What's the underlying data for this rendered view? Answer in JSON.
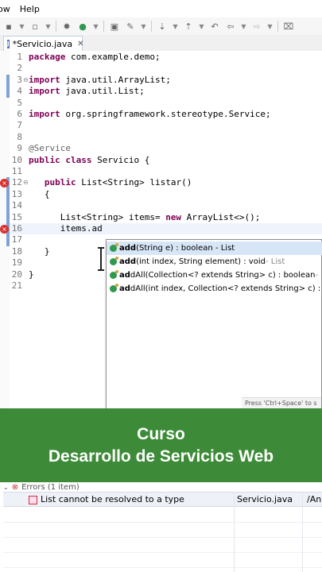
{
  "menu": {
    "items": [
      "ow",
      "Help"
    ]
  },
  "editor_tab": {
    "title": "*Servicio.java",
    "close": "✕"
  },
  "code": {
    "lines": [
      {
        "n": "1",
        "parts": [
          [
            "kw",
            "package"
          ],
          [
            "txt",
            " com.example.demo;"
          ]
        ]
      },
      {
        "n": "2",
        "parts": []
      },
      {
        "n": "3",
        "parts": [
          [
            "kw",
            "import"
          ],
          [
            "txt",
            " java.util.ArrayList;"
          ]
        ]
      },
      {
        "n": "4",
        "parts": [
          [
            "kw",
            "import"
          ],
          [
            "txt",
            " java.util.List;"
          ]
        ]
      },
      {
        "n": "5",
        "parts": []
      },
      {
        "n": "6",
        "parts": [
          [
            "kw",
            "import"
          ],
          [
            "txt",
            " org.springframework.stereotype.Service;"
          ]
        ]
      },
      {
        "n": "7",
        "parts": []
      },
      {
        "n": "8",
        "parts": []
      },
      {
        "n": "9",
        "parts": [
          [
            "ann",
            "@Service"
          ]
        ]
      },
      {
        "n": "10",
        "parts": [
          [
            "kw",
            "public class"
          ],
          [
            "txt",
            " Servicio {"
          ]
        ]
      },
      {
        "n": "11",
        "parts": []
      },
      {
        "n": "12",
        "parts": [
          [
            "txt",
            "   "
          ],
          [
            "kw",
            "public"
          ],
          [
            "txt",
            " List<String> listar()"
          ]
        ]
      },
      {
        "n": "13",
        "parts": [
          [
            "txt",
            "   {"
          ]
        ]
      },
      {
        "n": "14",
        "parts": []
      },
      {
        "n": "15",
        "parts": [
          [
            "txt",
            "      List<String> items= "
          ],
          [
            "kw",
            "new"
          ],
          [
            "txt",
            " ArrayList<>();"
          ]
        ]
      },
      {
        "n": "16",
        "parts": [
          [
            "txt",
            "      items.ad"
          ]
        ]
      },
      {
        "n": "17",
        "parts": []
      },
      {
        "n": "18",
        "parts": [
          [
            "txt",
            "   }"
          ]
        ]
      },
      {
        "n": "19",
        "parts": []
      },
      {
        "n": "20",
        "parts": [
          [
            "txt",
            "}"
          ]
        ]
      },
      {
        "n": "21",
        "parts": []
      }
    ]
  },
  "autocomplete": {
    "items": [
      {
        "bold": "add",
        "rest": "(String e) : boolean - List",
        "dim": ""
      },
      {
        "bold": "add",
        "rest": "(int index, String element) : void",
        "dim": " - List"
      },
      {
        "bold": "ad",
        "rest": "dAll(Collection<? extends String> c) : boolean",
        "dim": " - Li"
      },
      {
        "bold": "ad",
        "rest": "dAll(int index, Collection<? extends String> c) : boo",
        "dim": ""
      }
    ],
    "hint": "Press 'Ctrl+Space' to s"
  },
  "banner": {
    "line1": "Curso",
    "line2": "Desarrollo de Servicios Web"
  },
  "problems": {
    "header": "Errors (1 item)",
    "row": {
      "description": "List cannot be resolved to a type",
      "resource": "Servicio.java",
      "path": "/An"
    }
  },
  "colors": {
    "banner": "#3d8b38",
    "keyword": "#7f0055",
    "annotation": "#646464",
    "selection": "#d7e6f7"
  }
}
